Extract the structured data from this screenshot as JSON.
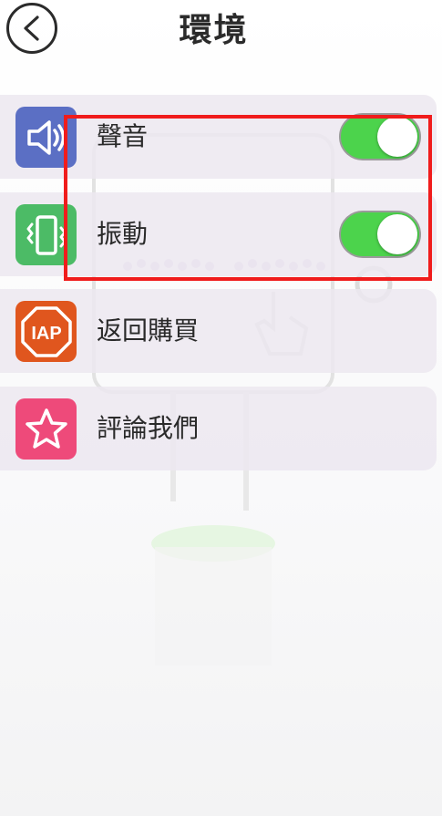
{
  "header": {
    "title": "環境"
  },
  "settings": {
    "items": [
      {
        "label": "聲音",
        "icon": "speaker-icon",
        "color": "#5b6fc4",
        "toggle": true
      },
      {
        "label": "振動",
        "icon": "vibrate-phone-icon",
        "color": "#4cbb66",
        "toggle": true
      },
      {
        "label": "返回購買",
        "icon": "iap-icon",
        "icon_text": "IAP",
        "color": "#e0561e"
      },
      {
        "label": "評論我們",
        "icon": "star-icon",
        "color": "#ee4a7a"
      }
    ]
  },
  "colors": {
    "toggle_on": "#4cd34c",
    "highlight": "#f01c1c",
    "row_background": "#ece8f0"
  }
}
